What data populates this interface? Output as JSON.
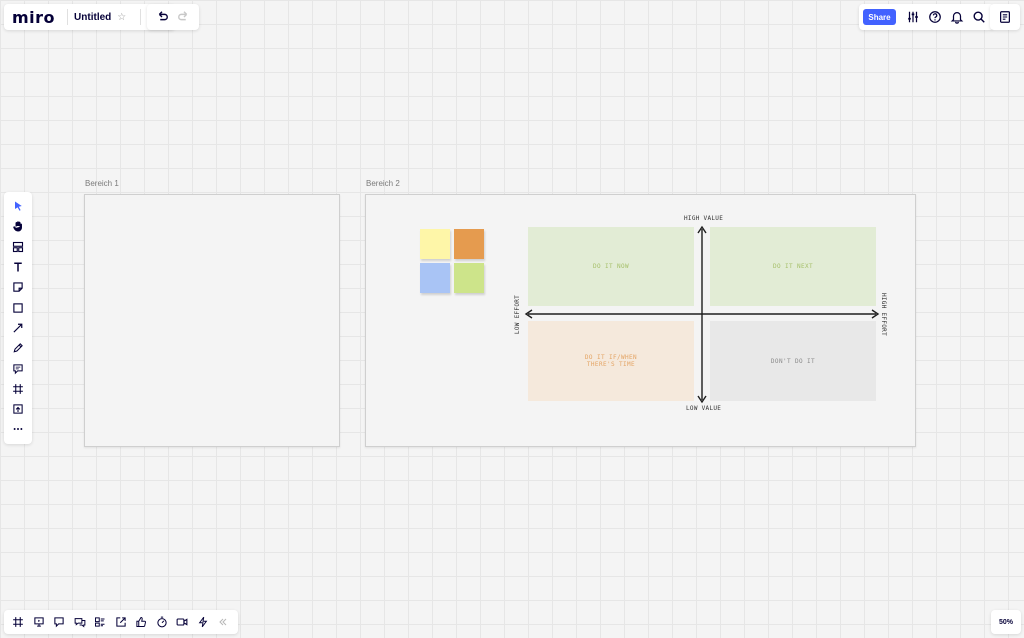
{
  "header": {
    "logo": "miro",
    "board_title": "Untitled",
    "star_icon": "star-icon",
    "share_label": "Share"
  },
  "icons": {
    "top_left": [
      "upload-icon"
    ],
    "undo": [
      "undo-icon",
      "redo-icon"
    ],
    "top_right": [
      "settings-sliders-icon",
      "help-icon",
      "bell-icon",
      "search-icon"
    ],
    "notes": "notes-icon",
    "left_toolbar": [
      "cursor-icon",
      "hand-icon",
      "templates-icon",
      "text-icon",
      "sticky-note-icon",
      "shape-icon",
      "connection-line-icon",
      "pen-icon",
      "comment-icon",
      "frame-icon",
      "upload-icon",
      "more-icon"
    ],
    "bottom_toolbar": [
      "frames-icon",
      "presentation-icon",
      "comments-icon",
      "chat-icon",
      "cards-icon",
      "share-screen-icon",
      "voting-icon",
      "timer-icon",
      "video-icon",
      "lightning-icon",
      "collapse-icon"
    ]
  },
  "canvas": {
    "frames": [
      {
        "label": "Bereich 1"
      },
      {
        "label": "Bereich 2"
      }
    ],
    "sticky_colors": [
      "#fef6a8",
      "#e59b4f",
      "#a9c4f5",
      "#cde48a"
    ],
    "matrix": {
      "high_value": "HIGH VALUE",
      "low_value": "LOW VALUE",
      "low_effort": "LOW EFFORT",
      "high_effort": "HIGH EFFORT",
      "quadrants": [
        {
          "label": "DO IT NOW",
          "bg": "#e2ecd5",
          "color": "#a6c06a"
        },
        {
          "label": "DO IT NEXT",
          "bg": "#e2ecd5",
          "color": "#a6c06a"
        },
        {
          "label": "DO IT IF/WHEN\nTHERE'S TIME",
          "bg": "#f5e9dc",
          "color": "#e4a464"
        },
        {
          "label": "DON'T DO IT",
          "bg": "#e8e8e8",
          "color": "#8a8a8a"
        }
      ]
    }
  },
  "zoom": "50%"
}
